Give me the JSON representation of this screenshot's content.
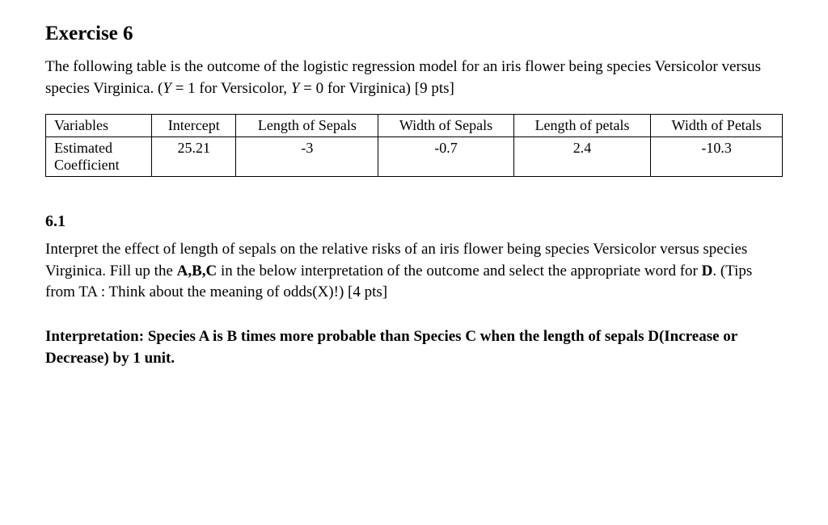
{
  "heading": "Exercise 6",
  "intro_a": "The following table is the outcome of the logistic regression model for an iris flower being species Versicolor versus species Virginica. (",
  "intro_y1": "Y",
  "intro_b": " = 1 for Versicolor, ",
  "intro_y2": "Y",
  "intro_c": " = 0 for Virginica) [9 pts]",
  "table": {
    "row1_label": "Variables",
    "headers": [
      "Intercept",
      "Length of Sepals",
      "Width of Sepals",
      "Length of petals",
      "Width of Petals"
    ],
    "row2_label_line1": "Estimated",
    "row2_label_line2": "Coefficient",
    "values": [
      "25.21",
      "-3",
      "-0.7",
      "2.4",
      "-10.3"
    ]
  },
  "section_num": "6.1",
  "q_a": "Interpret the effect of length of sepals on the relative risks of an iris flower being species Versi­color versus species Virginica. Fill up the ",
  "q_bold": "A,B,C",
  "q_b": " in the below interpretation of the outcome and select the appropriate word for ",
  "q_bold2": "D",
  "q_c": ". (Tips from TA : Think about the meaning of odds(X)!) [4 pts]",
  "interp": "Interpretation: Species A is B times more probable than Species C when the length of sepals D(Increase or Decrease) by 1 unit.",
  "chart_data": {
    "type": "table",
    "columns": [
      "Variables",
      "Intercept",
      "Length of Sepals",
      "Width of Sepals",
      "Length of petals",
      "Width of Petals"
    ],
    "rows": [
      {
        "Variables": "Estimated Coefficient",
        "Intercept": 25.21,
        "Length of Sepals": -3,
        "Width of Sepals": -0.7,
        "Length of petals": 2.4,
        "Width of Petals": -10.3
      }
    ],
    "title": "Logistic regression model for iris species (Versicolor vs Virginica)"
  }
}
